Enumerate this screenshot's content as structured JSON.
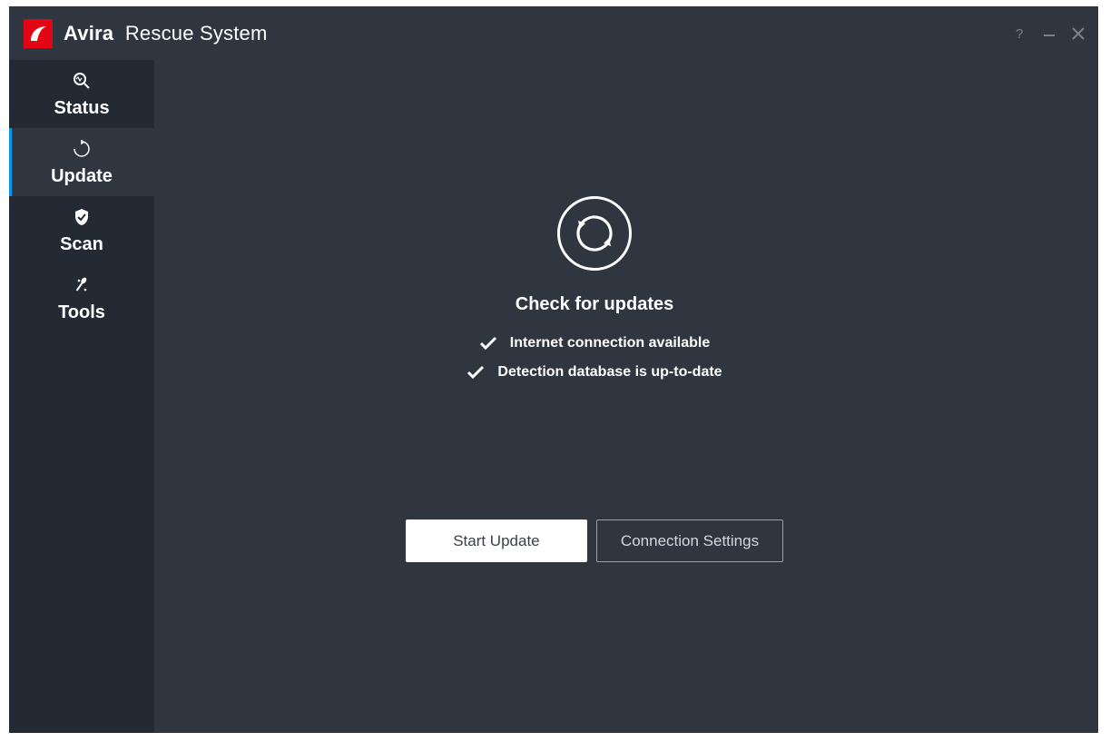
{
  "header": {
    "brand": "Avira",
    "product": "Rescue System"
  },
  "sidebar": {
    "items": [
      {
        "label": "Status"
      },
      {
        "label": "Update"
      },
      {
        "label": "Scan"
      },
      {
        "label": "Tools"
      }
    ]
  },
  "main": {
    "heading": "Check for updates",
    "status_internet": "Internet connection available",
    "status_database": "Detection database is up-to-date",
    "btn_start": "Start Update",
    "btn_conn": "Connection Settings"
  }
}
